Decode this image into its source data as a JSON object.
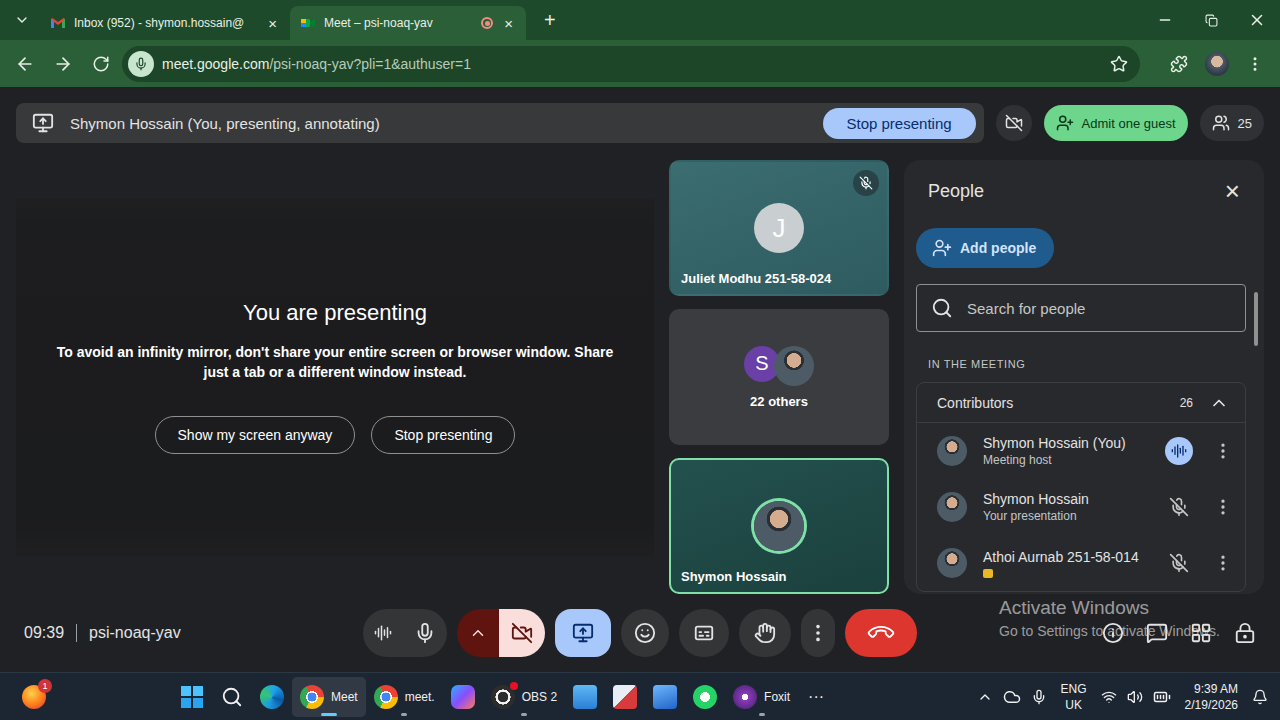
{
  "browser": {
    "tabs": [
      {
        "label": "Inbox (952) - shymon.hossain@",
        "close": "×",
        "selected": false,
        "recording": false,
        "favicon": "gmail"
      },
      {
        "label": "Meet – psi-noaq-yav",
        "close": "×",
        "selected": true,
        "recording": true,
        "favicon": "meet"
      }
    ],
    "new_tab": "+",
    "url": {
      "host": "meet.google.com",
      "path": "/psi-noaq-yav?pli=1&authuser=1"
    }
  },
  "meet": {
    "presenting_bar": {
      "label": "Shymon Hossain (You, presenting, annotating)",
      "button": "Stop presenting",
      "admit": "Admit one guest",
      "participants": "25"
    },
    "presentation": {
      "title": "You are presenting",
      "message": "To avoid an infinity mirror, don't share your entire screen or browser window. Share just a tab or a different window instead.",
      "buttons": [
        "Show my screen anyway",
        "Stop presenting"
      ]
    },
    "tiles": [
      {
        "kind": "letter",
        "name": "Juliet Modhu 251-58-024",
        "initial": "J",
        "muted": true,
        "active": false
      },
      {
        "kind": "group",
        "name": "22 others",
        "initial": "S",
        "muted": false,
        "active": false
      },
      {
        "kind": "photo",
        "name": "Shymon Hossain",
        "muted": false,
        "active": true
      }
    ],
    "people": {
      "title": "People",
      "close": "×",
      "add": "Add people",
      "search": "Search for people",
      "section": "IN THE MEETING",
      "group": {
        "label": "Contributors",
        "count": "26",
        "expanded": true
      },
      "members": [
        {
          "name": "Shymon Hossain (You)",
          "role": "Meeting host",
          "speaking": true,
          "muted": false,
          "badge": false
        },
        {
          "name": "Shymon Hossain",
          "role": "Your presentation",
          "speaking": false,
          "muted": true,
          "badge": false
        },
        {
          "name": "Athoi Aurnab 251-58-014",
          "speaking": false,
          "muted": true,
          "badge": true
        }
      ]
    },
    "footer": {
      "time": "09:39",
      "code": "psi-noaq-yav"
    },
    "controls": [
      {
        "kind": "levels",
        "on": true
      },
      {
        "kind": "mic",
        "on": true
      },
      {
        "kind": "camera-options",
        "on": false
      },
      {
        "kind": "camera",
        "on": false
      },
      {
        "kind": "present",
        "on": true
      },
      {
        "kind": "emoji",
        "on": false
      },
      {
        "kind": "captions",
        "on": false
      },
      {
        "kind": "hand",
        "on": false
      },
      {
        "kind": "more",
        "on": false
      },
      {
        "kind": "leave",
        "on": false
      }
    ]
  },
  "watermark": {
    "title": "Activate Windows",
    "subtitle": "Go to Settings to activate Windows."
  },
  "taskbar": {
    "pinned": {
      "kind": "fox",
      "badge": "1"
    },
    "apps": [
      {
        "kind": "start",
        "running": false,
        "selected": false
      },
      {
        "kind": "search",
        "running": false,
        "selected": false
      },
      {
        "kind": "edge",
        "running": false,
        "selected": false
      },
      {
        "kind": "chrome",
        "label": "Meet",
        "running": true,
        "selected": true
      },
      {
        "kind": "chrome",
        "label": "meet.",
        "running": true,
        "selected": false
      },
      {
        "kind": "copilot",
        "running": false,
        "selected": false
      },
      {
        "kind": "obs",
        "label": "OBS 2",
        "running": true,
        "selected": false
      },
      {
        "kind": "files",
        "running": false,
        "selected": false
      },
      {
        "kind": "tool",
        "running": false,
        "selected": false
      },
      {
        "kind": "mail",
        "running": false,
        "selected": false
      },
      {
        "kind": "whatsapp",
        "running": false,
        "selected": false
      },
      {
        "kind": "foxit",
        "label": "Foxit",
        "running": true,
        "selected": false
      }
    ],
    "overflow": "···",
    "tray": {
      "language": "ENG",
      "region": "UK",
      "time": "9:39 AM",
      "date": "2/19/2026"
    }
  }
}
